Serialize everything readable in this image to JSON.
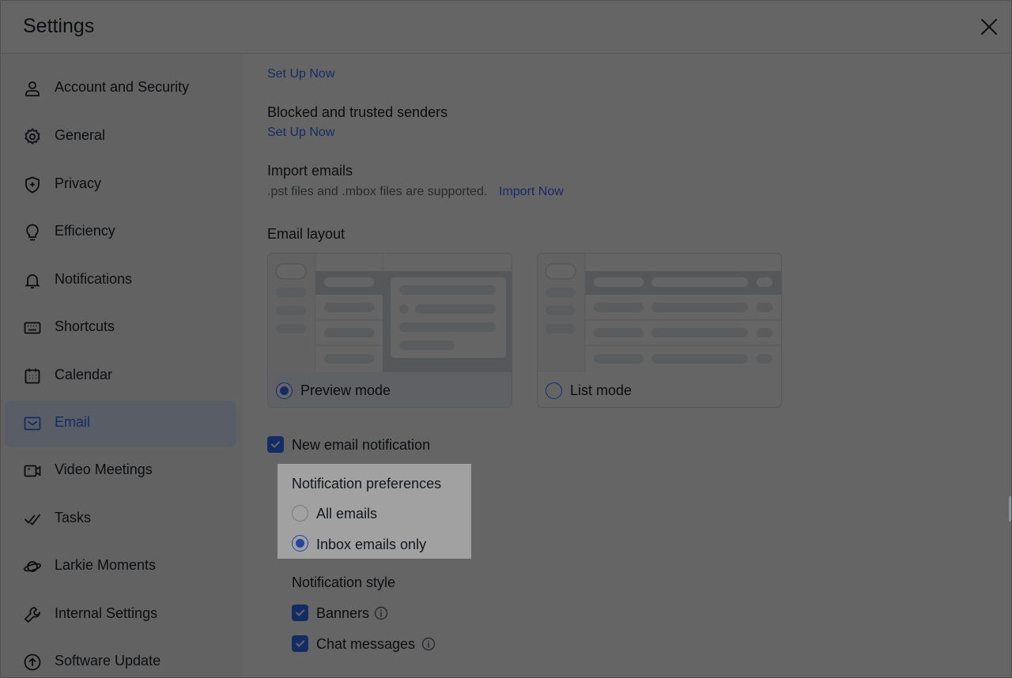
{
  "window": {
    "title": "Settings"
  },
  "sidebar": {
    "items": [
      {
        "label": "Account and Security",
        "icon": "person-icon"
      },
      {
        "label": "General",
        "icon": "gear-icon"
      },
      {
        "label": "Privacy",
        "icon": "shield-icon"
      },
      {
        "label": "Efficiency",
        "icon": "lightbulb-icon"
      },
      {
        "label": "Notifications",
        "icon": "bell-icon"
      },
      {
        "label": "Shortcuts",
        "icon": "keyboard-icon"
      },
      {
        "label": "Calendar",
        "icon": "calendar-icon"
      },
      {
        "label": "Email",
        "icon": "mail-icon",
        "active": true
      },
      {
        "label": "Video Meetings",
        "icon": "video-camera-icon"
      },
      {
        "label": "Tasks",
        "icon": "tasks-check-icon"
      },
      {
        "label": "Larkie Moments",
        "icon": "planet-icon"
      },
      {
        "label": "Internal Settings",
        "icon": "wrench-icon"
      },
      {
        "label": "Software Update",
        "icon": "upload-arrow-icon"
      }
    ]
  },
  "main": {
    "top_link": "Set Up Now",
    "blocked_senders": {
      "title": "Blocked and trusted senders",
      "link": "Set Up Now"
    },
    "import_emails": {
      "title": "Import emails",
      "description": ".pst files and .mbox files are supported.",
      "link": "Import Now"
    },
    "email_layout": {
      "title": "Email layout",
      "options": [
        {
          "label": "Preview mode",
          "selected": true
        },
        {
          "label": "List mode",
          "selected": false
        }
      ]
    },
    "new_email_notification": {
      "label": "New email notification",
      "checked": true
    },
    "notification_preferences": {
      "title": "Notification preferences",
      "options": [
        {
          "label": "All emails",
          "selected": false
        },
        {
          "label": "Inbox emails only",
          "selected": true
        }
      ]
    },
    "notification_style": {
      "title": "Notification style",
      "options": [
        {
          "label": "Banners",
          "checked": true
        },
        {
          "label": "Chat messages",
          "checked": true
        }
      ]
    }
  },
  "colors": {
    "accent": "#3370ff",
    "active_bg": "#e1eaff",
    "sidebar_bg": "#f5f6f7"
  }
}
